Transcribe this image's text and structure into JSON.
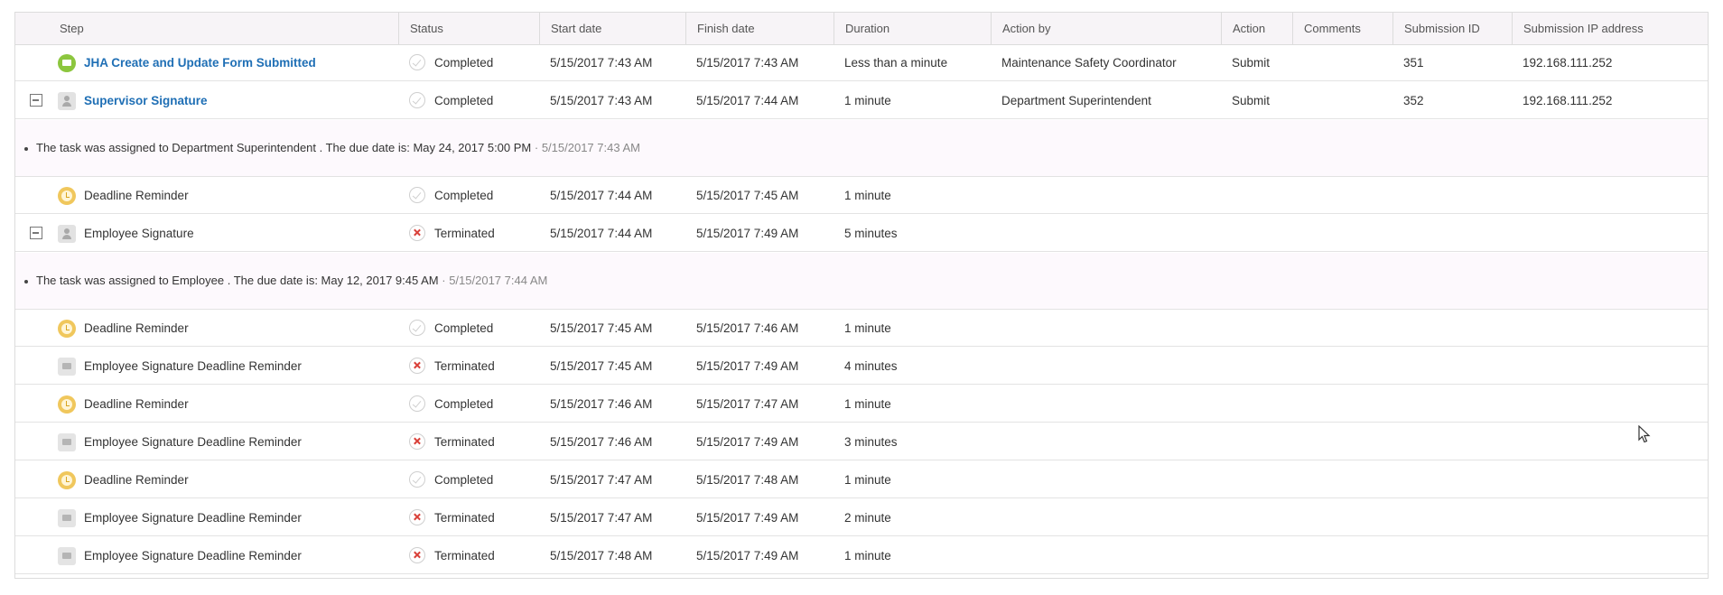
{
  "columns": [
    "Step",
    "Status",
    "Start date",
    "Finish date",
    "Duration",
    "Action by",
    "Action",
    "Comments",
    "Submission ID",
    "Submission IP address"
  ],
  "rows": [
    {
      "kind": "row",
      "icon": "form-icon",
      "step": "JHA Create and Update Form Submitted",
      "link": true,
      "collapsible": false,
      "status": "Completed",
      "start": "5/15/2017 7:43 AM",
      "finish": "5/15/2017 7:43 AM",
      "duration": "Less than a minute",
      "action_by": "Maintenance Safety Coordinator",
      "action": "Submit",
      "comments": "",
      "submission_id": "351",
      "ip": "192.168.111.252"
    },
    {
      "kind": "row",
      "icon": "person-icon",
      "step": "Supervisor Signature",
      "link": true,
      "collapsible": true,
      "status": "Completed",
      "start": "5/15/2017 7:43 AM",
      "finish": "5/15/2017 7:44 AM",
      "duration": "1 minute",
      "action_by": "Department Superintendent",
      "action": "Submit",
      "comments": "",
      "submission_id": "352",
      "ip": "192.168.111.252"
    },
    {
      "kind": "detail",
      "text": "The task was assigned to Department Superintendent . The due date is: May 24, 2017 5:00 PM",
      "sep": " · ",
      "timestamp": "5/15/2017 7:43 AM"
    },
    {
      "kind": "row",
      "icon": "clock-icon",
      "step": "Deadline Reminder",
      "link": false,
      "collapsible": false,
      "status": "Completed",
      "start": "5/15/2017 7:44 AM",
      "finish": "5/15/2017 7:45 AM",
      "duration": "1 minute",
      "action_by": "",
      "action": "",
      "comments": "",
      "submission_id": "",
      "ip": ""
    },
    {
      "kind": "row",
      "icon": "person-icon",
      "step": "Employee Signature",
      "link": false,
      "collapsible": true,
      "status": "Terminated",
      "start": "5/15/2017 7:44 AM",
      "finish": "5/15/2017 7:49 AM",
      "duration": "5 minutes",
      "action_by": "",
      "action": "",
      "comments": "",
      "submission_id": "",
      "ip": ""
    },
    {
      "kind": "detail",
      "text": "The task was assigned to Employee . The due date is: May 12, 2017 9:45 AM",
      "sep": " · ",
      "timestamp": "5/15/2017 7:44 AM"
    },
    {
      "kind": "row",
      "icon": "clock-icon",
      "step": "Deadline Reminder",
      "link": false,
      "collapsible": false,
      "status": "Completed",
      "start": "5/15/2017 7:45 AM",
      "finish": "5/15/2017 7:46 AM",
      "duration": "1 minute",
      "action_by": "",
      "action": "",
      "comments": "",
      "submission_id": "",
      "ip": ""
    },
    {
      "kind": "row",
      "icon": "mail-icon",
      "step": "Employee Signature Deadline Reminder",
      "link": false,
      "collapsible": false,
      "status": "Terminated",
      "start": "5/15/2017 7:45 AM",
      "finish": "5/15/2017 7:49 AM",
      "duration": "4 minutes",
      "action_by": "",
      "action": "",
      "comments": "",
      "submission_id": "",
      "ip": ""
    },
    {
      "kind": "row",
      "icon": "clock-icon",
      "step": "Deadline Reminder",
      "link": false,
      "collapsible": false,
      "status": "Completed",
      "start": "5/15/2017 7:46 AM",
      "finish": "5/15/2017 7:47 AM",
      "duration": "1 minute",
      "action_by": "",
      "action": "",
      "comments": "",
      "submission_id": "",
      "ip": ""
    },
    {
      "kind": "row",
      "icon": "mail-icon",
      "step": "Employee Signature Deadline Reminder",
      "link": false,
      "collapsible": false,
      "status": "Terminated",
      "start": "5/15/2017 7:46 AM",
      "finish": "5/15/2017 7:49 AM",
      "duration": "3 minutes",
      "action_by": "",
      "action": "",
      "comments": "",
      "submission_id": "",
      "ip": ""
    },
    {
      "kind": "row",
      "icon": "clock-icon",
      "step": "Deadline Reminder",
      "link": false,
      "collapsible": false,
      "status": "Completed",
      "start": "5/15/2017 7:47 AM",
      "finish": "5/15/2017 7:48 AM",
      "duration": "1 minute",
      "action_by": "",
      "action": "",
      "comments": "",
      "submission_id": "",
      "ip": ""
    },
    {
      "kind": "row",
      "icon": "mail-icon",
      "step": "Employee Signature Deadline Reminder",
      "link": false,
      "collapsible": false,
      "status": "Terminated",
      "start": "5/15/2017 7:47 AM",
      "finish": "5/15/2017 7:49 AM",
      "duration": "2 minute",
      "action_by": "",
      "action": "",
      "comments": "",
      "submission_id": "",
      "ip": ""
    },
    {
      "kind": "row",
      "icon": "mail-icon",
      "step": "Employee Signature Deadline Reminder",
      "link": false,
      "collapsible": false,
      "status": "Terminated",
      "start": "5/15/2017 7:48 AM",
      "finish": "5/15/2017 7:49 AM",
      "duration": "1 minute",
      "action_by": "",
      "action": "",
      "comments": "",
      "submission_id": "",
      "ip": ""
    }
  ],
  "colors": {
    "link": "#1f6fb5",
    "header_bg": "#f7f4f7",
    "detail_bg": "#fdf9fd",
    "terminated_x": "#d9413a",
    "clock_icon": "#f0c75c",
    "form_icon": "#8cc63e"
  }
}
